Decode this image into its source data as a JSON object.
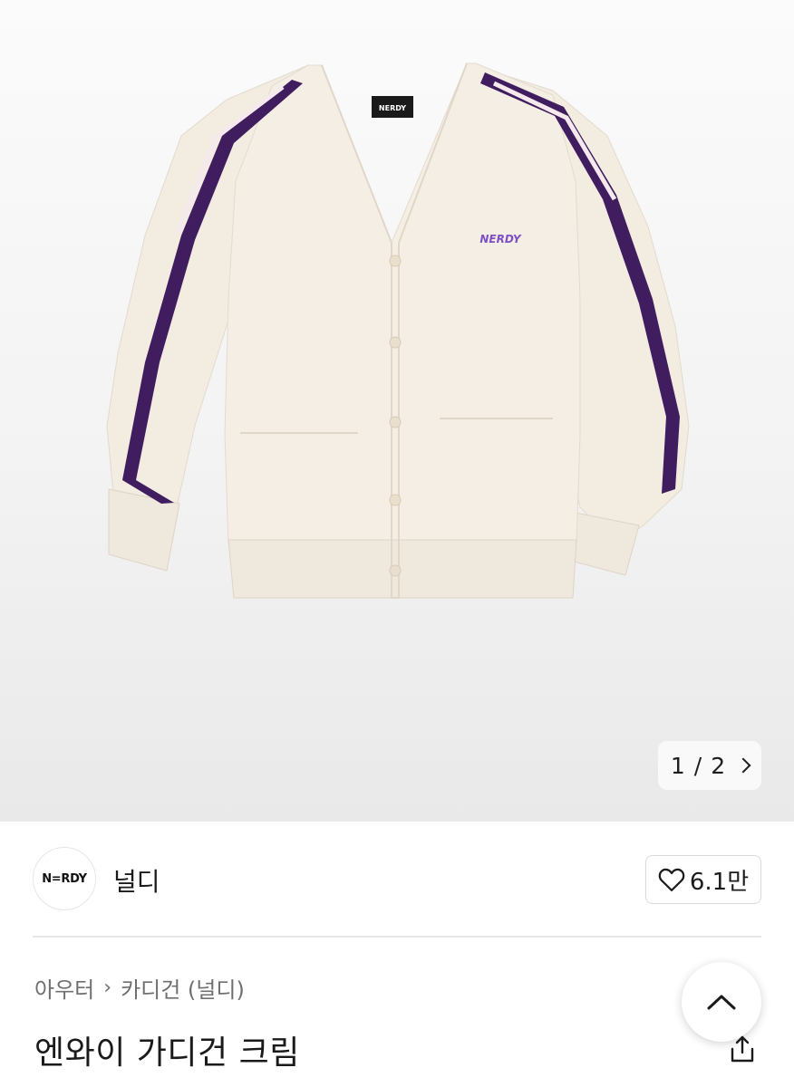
{
  "gallery": {
    "current": "1",
    "separator": "/",
    "total": "2",
    "product_colors": {
      "body": "#f3ede2",
      "stripe": "#3f1d5e",
      "logo": "#7f4fc4"
    },
    "garment_logo": "NERDY",
    "label_text": "NERDY"
  },
  "brand": {
    "logo_text": "N=RDY",
    "name": "널디"
  },
  "like": {
    "count": "6.1만"
  },
  "breadcrumb": {
    "category": "아우터",
    "subcategory": "카디건 (널디)"
  },
  "product": {
    "title": "엔와이 가디건 크림"
  }
}
